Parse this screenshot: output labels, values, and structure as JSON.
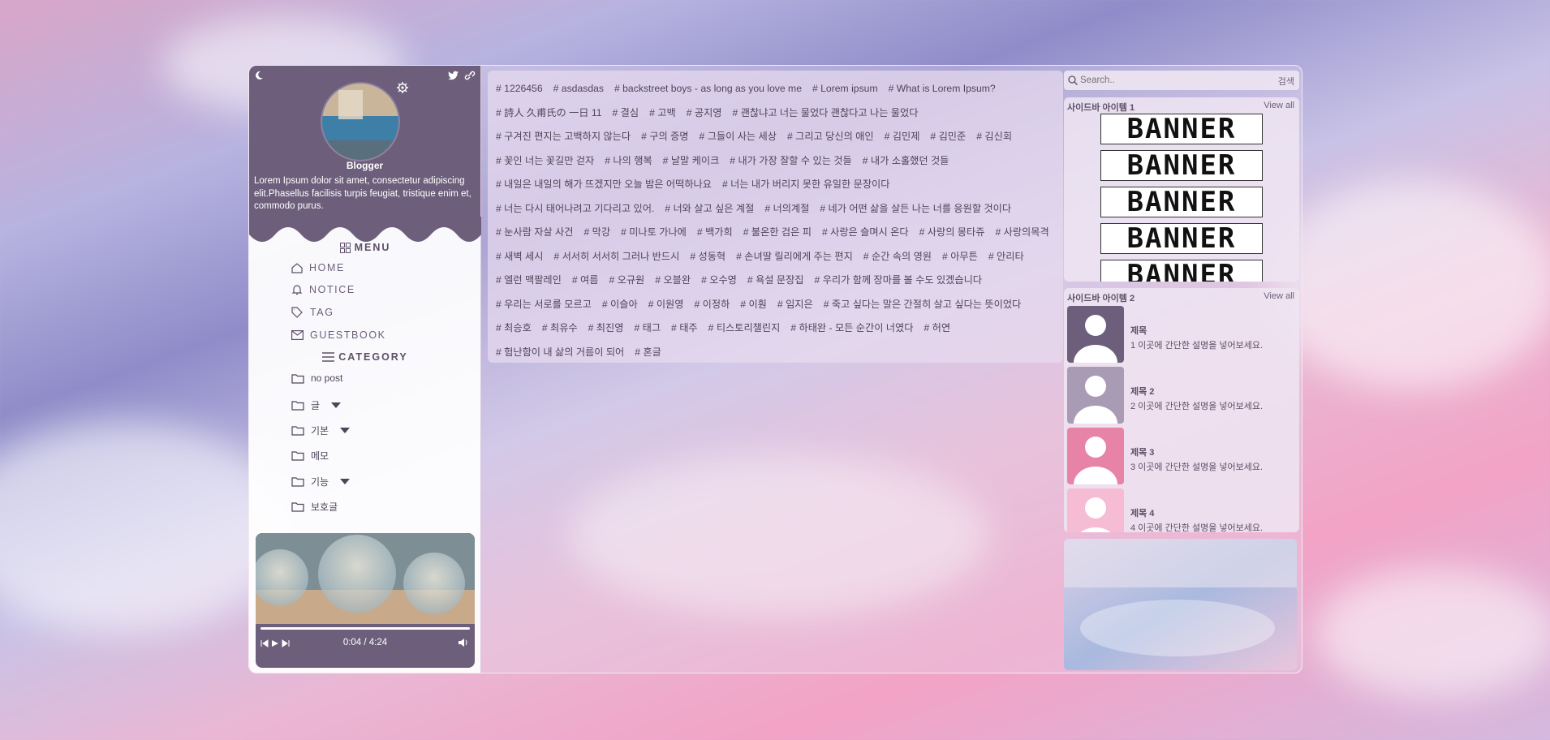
{
  "colors": {
    "accent": "#6d5f7b",
    "bg_pink": "#f2a3c6",
    "bg_purple": "#8f8cc9"
  },
  "profile": {
    "name": "Blogger",
    "description": "Lorem Ipsum dolor sit amet, consectetur adipiscing elit.Phasellus facilisis turpis feugiat, tristique enim et, commodo purus."
  },
  "menu": {
    "title": "MENU",
    "items": [
      {
        "label": "HOME",
        "icon": "home-icon"
      },
      {
        "label": "NOTICE",
        "icon": "bell-icon"
      },
      {
        "label": "TAG",
        "icon": "tag-icon"
      },
      {
        "label": "GUESTBOOK",
        "icon": "mail-icon"
      }
    ]
  },
  "category": {
    "title": "CATEGORY",
    "items": [
      {
        "label": "no post",
        "expandable": false
      },
      {
        "label": "글",
        "expandable": true
      },
      {
        "label": "기본",
        "expandable": true
      },
      {
        "label": "메모",
        "expandable": false
      },
      {
        "label": "기능",
        "expandable": true
      },
      {
        "label": "보호글",
        "expandable": false
      }
    ]
  },
  "player": {
    "time": "0:04 / 4:24",
    "progress": 0.02
  },
  "tags": [
    "1226456",
    "asdasdas",
    "backstreet boys - as long as you love me",
    "Lorem ipsum",
    "What is Lorem Ipsum?",
    "詩人 久甫氏の 一日 11",
    "결심",
    "고백",
    "공지영",
    "괜찮냐고 너는 물었다 괜찮다고 나는 울었다",
    "구겨진 편지는 고백하지 않는다",
    "구의 증명",
    "그들이 사는 세상",
    "그리고 당신의 애인",
    "김민제",
    "김민준",
    "김신회",
    "꽃인 너는 꽃길만 걷자",
    "나의 행복",
    "날말 케이크",
    "내가 가장 잘할 수 있는 것들",
    "내가 소홀했던 것들",
    "내일은 내일의 해가 뜨겠지만 오늘 밤은 어떡하나요",
    "너는 내가 버리지 못한 유일한 문장이다",
    "너는 다시 태어나려고 기다리고 있어.",
    "너와 살고 싶은 계절",
    "너의계절",
    "네가 어떤 삶을 살든 나는 너를 응원할 것이다",
    "눈사람 자살 사건",
    "막강",
    "미나토 가나에",
    "백가희",
    "불온한 검은 피",
    "사랑은 슬며시 온다",
    "사랑의 몽타쥬",
    "사랑의목격",
    "새벽 세시",
    "서서히 서서히 그러나 반드시",
    "성동혁",
    "손녀딸 릴리에게 주는 편지",
    "순간 속의 영원",
    "아무튼",
    "안리타",
    "엘런 맥팔레인",
    "여름",
    "오규원",
    "오블완",
    "오수영",
    "욕설 문장집",
    "우리가 함께 장마를 볼 수도 있겠습니다",
    "우리는 서로를 모르고",
    "이슬아",
    "이원영",
    "이정하",
    "이훤",
    "임지은",
    "죽고 싶다는 말은 간절히 살고 싶다는 뜻이었다",
    "최승호",
    "최유수",
    "최진영",
    "태그",
    "태주",
    "티스토리챌린지",
    "하태완 - 모든 순간이 너였다",
    "허연",
    "험난함이 내 삶의 거름이 되어",
    "혼글"
  ],
  "search": {
    "placeholder": "Search..",
    "button": "검색"
  },
  "sidebar1": {
    "title": "사이드바 아이템 1",
    "link": "View all",
    "banners": [
      "BANNER",
      "BANNER",
      "BANNER",
      "BANNER",
      "BANNER"
    ]
  },
  "sidebar2": {
    "title": "사이드바 아이템 2",
    "link": "View all",
    "posts": [
      {
        "title": "제목",
        "desc": "1 이곳에 간단한 설명을 넣어보세요.",
        "color": "#6d5f7b"
      },
      {
        "title": "제목 2",
        "desc": "2 이곳에 간단한 설명을 넣어보세요.",
        "color": "#a99bb3"
      },
      {
        "title": "제목 3",
        "desc": "3 이곳에 간단한 설명을 넣어보세요.",
        "color": "#e883a8"
      },
      {
        "title": "제목 4",
        "desc": "4 이곳에 간단한 설명을 넣어보세요.",
        "color": "#f6bcd4"
      }
    ]
  }
}
